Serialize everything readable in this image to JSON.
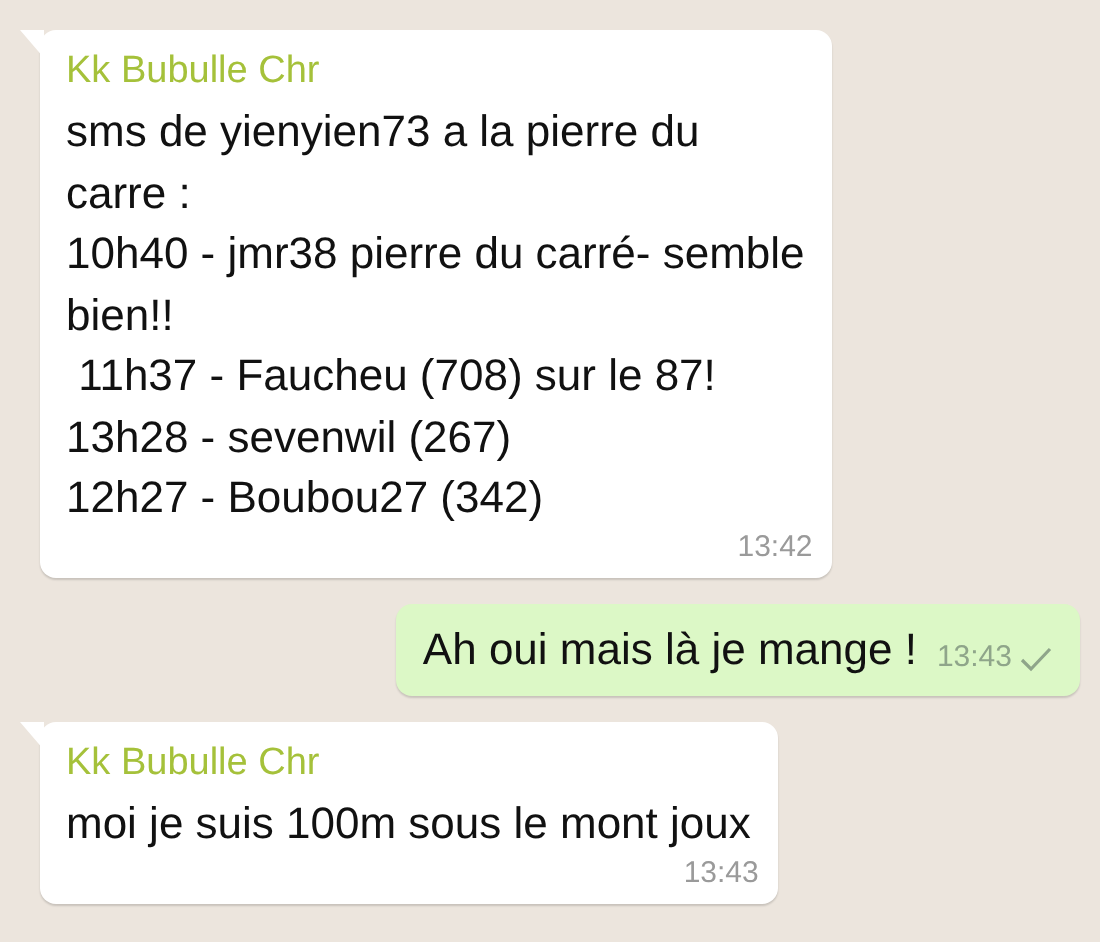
{
  "messages": [
    {
      "kind": "incoming",
      "sender": "Kk Bubulle Chr",
      "text": "sms de yienyien73 a la pierre du\ncarre :\n10h40 - jmr38 pierre du carré- semble\nbien!!\n 11h37 - Faucheu (708) sur le 87!\n13h28 - sevenwil (267)\n12h27 - Boubou27 (342)",
      "time": "13:42"
    },
    {
      "kind": "outgoing",
      "text": "Ah oui mais là je mange !",
      "time": "13:43",
      "sent": true
    },
    {
      "kind": "incoming",
      "sender": "Kk Bubulle Chr",
      "text": "moi je suis 100m sous le mont joux",
      "time": "13:43"
    }
  ]
}
